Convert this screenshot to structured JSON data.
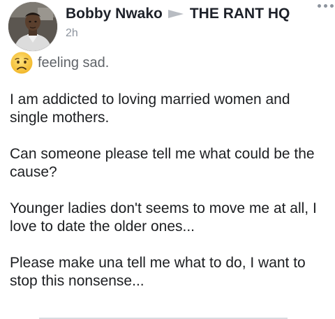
{
  "post": {
    "author": "Bobby Nwako",
    "group": "THE RANT HQ",
    "timestamp": "2h",
    "feeling_icon": "sad-face-emoji-icon",
    "feeling_text": "feeling sad.",
    "paragraphs": [
      "I am addicted to loving married women and single mothers.",
      "Can someone please tell me what could be the cause?",
      "Younger ladies don't seems to move me at all, I love to date the older ones...",
      "Please make una tell me what to do, I want to stop this nonsense..."
    ]
  },
  "icons": {
    "arrow": "right-triangle-icon",
    "more": "more-options-icon",
    "avatar": "profile-avatar-icon"
  },
  "colors": {
    "name": "#1d2129",
    "meta": "#8d949e",
    "body": "#1c1e21",
    "emoji_face": "#f7c93e"
  }
}
